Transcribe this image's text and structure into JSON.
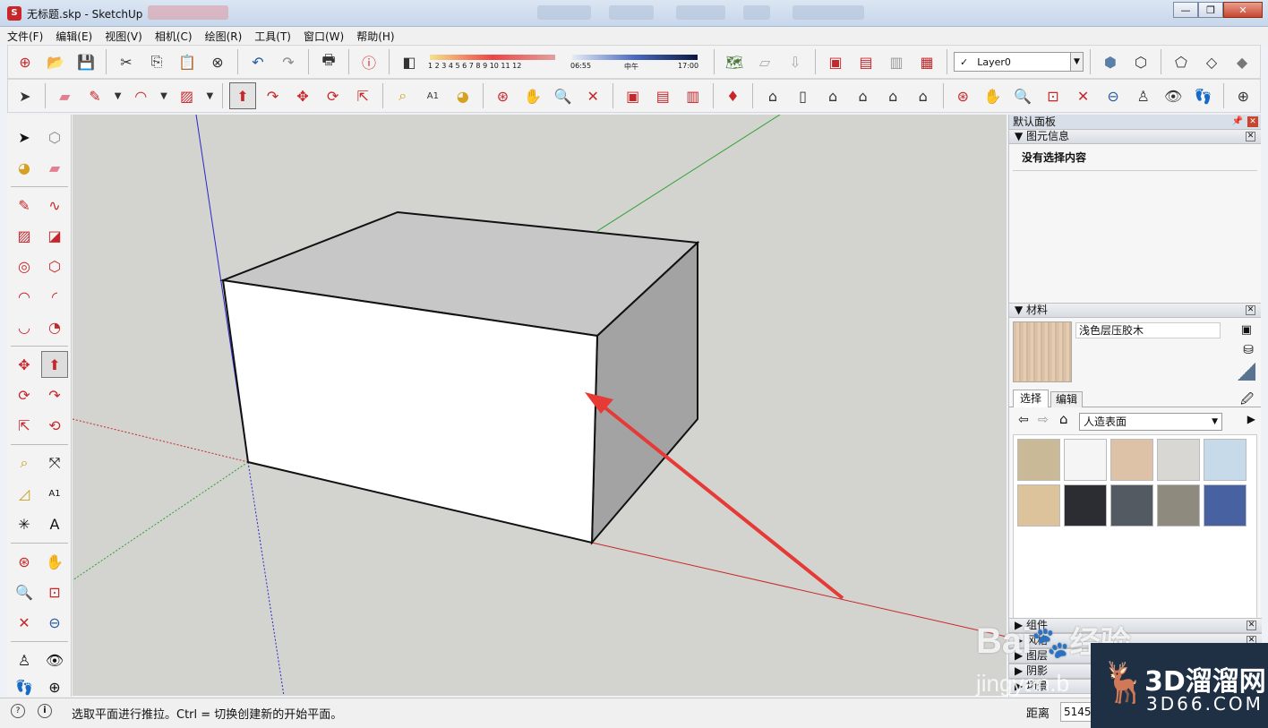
{
  "titlebar": {
    "title": "无标题.skp - SketchUp",
    "app_icon": "sketchup-icon"
  },
  "menubar": {
    "items": [
      "文件(F)",
      "编辑(E)",
      "视图(V)",
      "相机(C)",
      "绘图(R)",
      "工具(T)",
      "窗口(W)",
      "帮助(H)"
    ]
  },
  "toolbar": {
    "shadow_months": "1  2  3  4  5  6  7  8  9  10 11 12",
    "shadow_time_start": "06:55",
    "shadow_time_mid": "中午",
    "shadow_time_end": "17:00",
    "layer_value": "Layer0",
    "layer_check": "✓"
  },
  "viewport": {
    "selected_tool": "push-pull"
  },
  "panel": {
    "title": "默认面板",
    "entity_info": {
      "header": "图元信息",
      "status": "没有选择内容"
    },
    "materials": {
      "header": "材料",
      "current_name": "浅色层压胶木",
      "tabs": [
        "选择",
        "编辑"
      ],
      "library": "人造表面",
      "swatches": [
        "#c9b996",
        "#f5f5f5",
        "#ddc2a8",
        "#d8d7d4",
        "#c6daea",
        "#dcc39b",
        "#2b2d33",
        "#545a61",
        "#8e8b7e",
        "#4761a1"
      ]
    },
    "collapsed_sections": [
      "组件",
      "风格",
      "图层",
      "阴影",
      "场景"
    ]
  },
  "statusbar": {
    "message": "选取平面进行推拉。Ctrl = 切换创建新的开始平面。",
    "measure_label": "距离",
    "measure_value": "5145"
  },
  "watermark": {
    "logo_text": "Bai",
    "logo_text2": "经验",
    "url": "jingyan.b",
    "brand": "3D溜溜网",
    "brand_url": "3D66.COM"
  },
  "colors": {
    "axis_red": "#c8282a",
    "axis_green": "#2ea02e",
    "axis_blue": "#2828c8",
    "arrow": "#e53a36"
  }
}
